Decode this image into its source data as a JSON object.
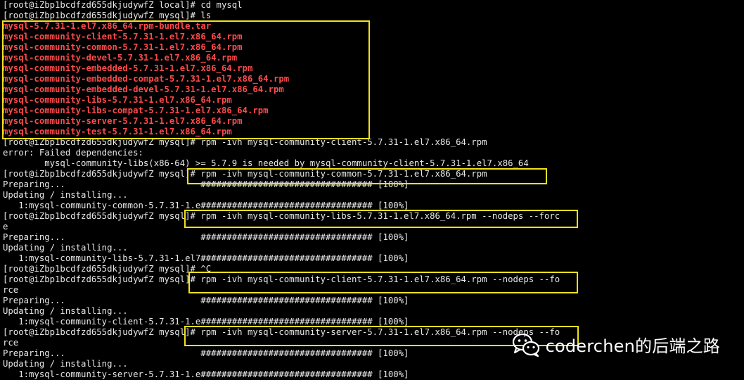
{
  "terminal": {
    "lines": [
      {
        "text": "[root@iZbp1bcdfzd655dkjudywfZ local]# cd mysql",
        "style": "normal"
      },
      {
        "text": "[root@iZbp1bcdfzd655dkjudywfZ mysql]# ls",
        "style": "normal"
      },
      {
        "text": "mysql-5.7.31-1.el7.x86_64.rpm-bundle.tar",
        "style": "red"
      },
      {
        "text": "mysql-community-client-5.7.31-1.el7.x86_64.rpm",
        "style": "red"
      },
      {
        "text": "mysql-community-common-5.7.31-1.el7.x86_64.rpm",
        "style": "red"
      },
      {
        "text": "mysql-community-devel-5.7.31-1.el7.x86_64.rpm",
        "style": "red"
      },
      {
        "text": "mysql-community-embedded-5.7.31-1.el7.x86_64.rpm",
        "style": "red"
      },
      {
        "text": "mysql-community-embedded-compat-5.7.31-1.el7.x86_64.rpm",
        "style": "red"
      },
      {
        "text": "mysql-community-embedded-devel-5.7.31-1.el7.x86_64.rpm",
        "style": "red"
      },
      {
        "text": "mysql-community-libs-5.7.31-1.el7.x86_64.rpm",
        "style": "red"
      },
      {
        "text": "mysql-community-libs-compat-5.7.31-1.el7.x86_64.rpm",
        "style": "red"
      },
      {
        "text": "mysql-community-server-5.7.31-1.el7.x86_64.rpm",
        "style": "red"
      },
      {
        "text": "mysql-community-test-5.7.31-1.el7.x86_64.rpm",
        "style": "red"
      },
      {
        "text": "[root@iZbp1bcdfzd655dkjudywfZ mysql]# rpm -ivh mysql-community-client-5.7.31-1.el7.x86_64.rpm",
        "style": "normal"
      },
      {
        "text": "error: Failed dependencies:",
        "style": "normal"
      },
      {
        "text": "        mysql-community-libs(x86-64) >= 5.7.9 is needed by mysql-community-client-5.7.31-1.el7.x86_64",
        "style": "normal"
      },
      {
        "text": "[root@iZbp1bcdfzd655dkjudywfZ mysql]# rpm -ivh mysql-community-common-5.7.31-1.el7.x86_64.rpm",
        "style": "normal"
      },
      {
        "text": "Preparing...                          ################################# [100%]",
        "style": "normal"
      },
      {
        "text": "Updating / installing...",
        "style": "normal"
      },
      {
        "text": "   1:mysql-community-common-5.7.31-1.e################################# [100%]",
        "style": "normal"
      },
      {
        "text": "[root@iZbp1bcdfzd655dkjudywfZ mysql]# rpm -ivh mysql-community-libs-5.7.31-1.el7.x86_64.rpm --nodeps --forc",
        "style": "normal"
      },
      {
        "text": "e",
        "style": "normal"
      },
      {
        "text": "Preparing...                          ################################# [100%]",
        "style": "normal"
      },
      {
        "text": "Updating / installing...",
        "style": "normal"
      },
      {
        "text": "   1:mysql-community-libs-5.7.31-1.el7################################# [100%]",
        "style": "normal"
      },
      {
        "text": "[root@iZbp1bcdfzd655dkjudywfZ mysql]# ^C",
        "style": "normal"
      },
      {
        "text": "[root@iZbp1bcdfzd655dkjudywfZ mysql]# rpm -ivh mysql-community-client-5.7.31-1.el7.x86_64.rpm --nodeps --fo",
        "style": "normal"
      },
      {
        "text": "rce",
        "style": "normal"
      },
      {
        "text": "Preparing...                          ################################# [100%]",
        "style": "normal"
      },
      {
        "text": "Updating / installing...",
        "style": "normal"
      },
      {
        "text": "   1:mysql-community-client-5.7.31-1.e################################# [100%]",
        "style": "normal"
      },
      {
        "text": "[root@iZbp1bcdfzd655dkjudywfZ mysql]# rpm -ivh mysql-community-server-5.7.31-1.el7.x86_64.rpm --nodeps --fo",
        "style": "normal"
      },
      {
        "text": "rce",
        "style": "normal"
      },
      {
        "text": "Preparing...                          ################################# [100%]",
        "style": "normal"
      },
      {
        "text": "Updating / installing...",
        "style": "normal"
      },
      {
        "text": "   1:mysql-community-server-5.7.31-1.e################################# [100%]",
        "style": "normal"
      }
    ],
    "colors": {
      "background": "#000000",
      "text": "#e8e8e8",
      "highlight_text": "#ff4a4a",
      "annotation_box": "#f2e01c"
    }
  },
  "watermark": {
    "text": "coderchen的后端之路",
    "icon": "wechat-icon"
  }
}
